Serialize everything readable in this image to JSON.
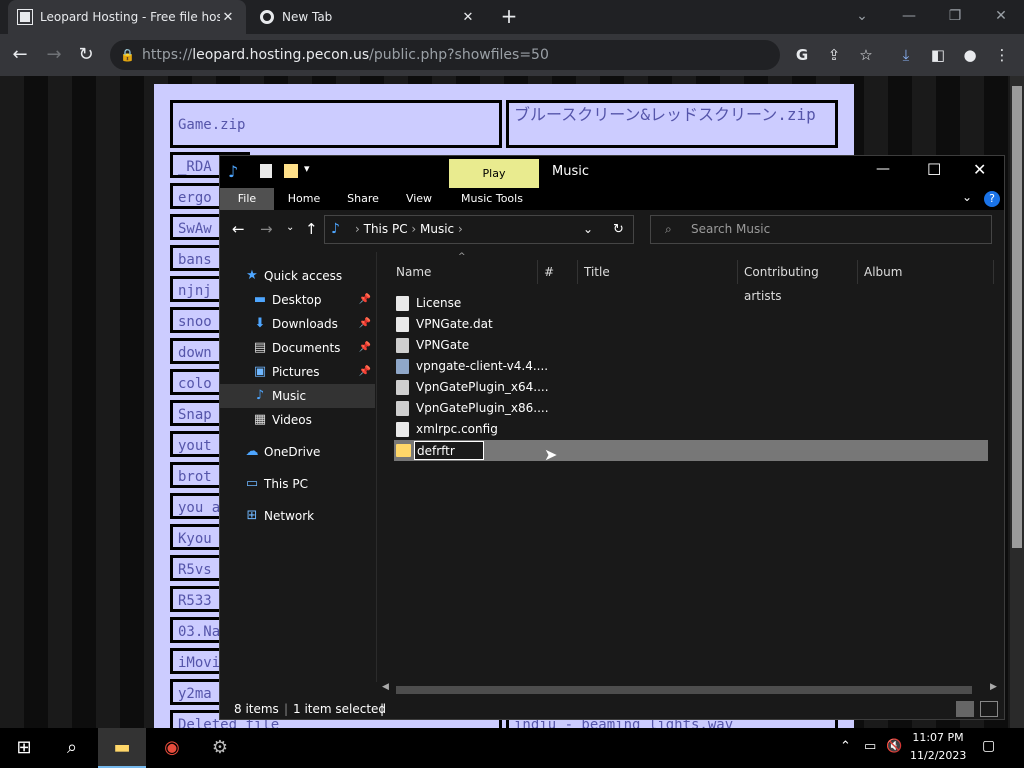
{
  "browser": {
    "tabs": [
      {
        "title": "Leopard Hosting - Free file hosti",
        "active": true
      },
      {
        "title": "New Tab",
        "active": false
      }
    ],
    "url_prefix": "https://",
    "url_host": "leopard.hosting.pecon.us",
    "url_path": "/public.php?showfiles=50",
    "icons": [
      "back-icon",
      "forward-icon",
      "reload-icon",
      "lock-icon",
      "google-icon",
      "share-icon",
      "star-icon",
      "download-icon",
      "sidebar-icon",
      "profile-icon",
      "menu-icon"
    ]
  },
  "page": {
    "file_cells": [
      "Game.zip",
      "ブルースクリーン&レッドスクリーン.zip",
      "_RDA",
      "ergo",
      "SwAw",
      "bans",
      "njnj",
      "snoo",
      "down",
      "colo",
      "Snap",
      "yout",
      "brot",
      "you a",
      "Kyou",
      "R5vs",
      "R533",
      "03.Na",
      "iMovi",
      "y2ma",
      "Deleted file",
      "indiu - beaming lights.wav"
    ]
  },
  "explorer": {
    "title": "Music",
    "play_tab": "Play",
    "ribbon_tabs": [
      "File",
      "Home",
      "Share",
      "View",
      "Music Tools"
    ],
    "breadcrumb": [
      "This PC",
      "Music"
    ],
    "search_placeholder": "Search Music",
    "nav": {
      "quick_access": "Quick access",
      "items": [
        {
          "label": "Desktop",
          "icon": "desktop-icon",
          "pinned": true
        },
        {
          "label": "Downloads",
          "icon": "downloads-icon",
          "pinned": true
        },
        {
          "label": "Documents",
          "icon": "documents-icon",
          "pinned": true
        },
        {
          "label": "Pictures",
          "icon": "pictures-icon",
          "pinned": true
        },
        {
          "label": "Music",
          "icon": "music-icon",
          "pinned": false,
          "selected": true
        },
        {
          "label": "Videos",
          "icon": "videos-icon",
          "pinned": false
        }
      ],
      "onedrive": "OneDrive",
      "this_pc": "This PC",
      "network": "Network"
    },
    "columns": [
      "Name",
      "#",
      "Title",
      "Contributing artists",
      "Album"
    ],
    "files": [
      {
        "name": "License",
        "icon": "file-icon"
      },
      {
        "name": "VPNGate.dat",
        "icon": "file-icon"
      },
      {
        "name": "VPNGate",
        "icon": "settings-file-icon"
      },
      {
        "name": "vpngate-client-v4.4....",
        "icon": "installer-icon"
      },
      {
        "name": "VpnGatePlugin_x64....",
        "icon": "settings-file-icon"
      },
      {
        "name": "VpnGatePlugin_x86....",
        "icon": "settings-file-icon"
      },
      {
        "name": "xmlrpc.config",
        "icon": "file-icon"
      }
    ],
    "rename_value": "defrftr",
    "status_items": "8 items",
    "status_selected": "1 item selected"
  },
  "taskbar": {
    "time": "11:07 PM",
    "date": "11/2/2023"
  }
}
